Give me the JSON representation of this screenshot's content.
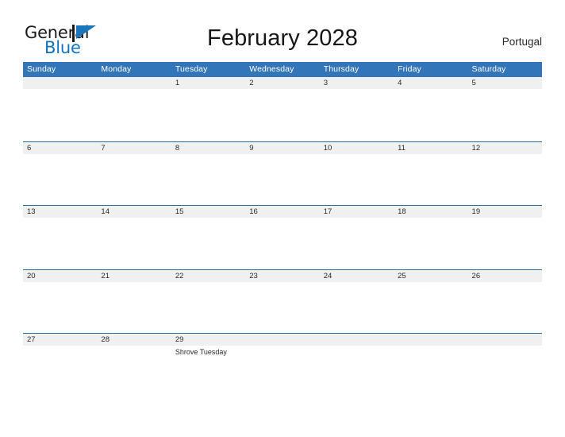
{
  "branding": {
    "name_part1": "General",
    "name_part2": "Blue",
    "flag_color": "#1b75bb",
    "pole_color": "#1a1a1a"
  },
  "header": {
    "title": "February 2028",
    "locale": "Portugal"
  },
  "colors": {
    "weekday_header_bg": "#3275b8",
    "weekday_header_text": "#ffffff",
    "row_divider": "#2a6ba8",
    "date_band_bg": "#f0f0f0",
    "text": "#2b2b2b"
  },
  "calendar": {
    "weekdays": [
      "Sunday",
      "Monday",
      "Tuesday",
      "Wednesday",
      "Thursday",
      "Friday",
      "Saturday"
    ],
    "weeks": [
      [
        {
          "day": "",
          "events": []
        },
        {
          "day": "",
          "events": []
        },
        {
          "day": "1",
          "events": []
        },
        {
          "day": "2",
          "events": []
        },
        {
          "day": "3",
          "events": []
        },
        {
          "day": "4",
          "events": []
        },
        {
          "day": "5",
          "events": []
        }
      ],
      [
        {
          "day": "6",
          "events": []
        },
        {
          "day": "7",
          "events": []
        },
        {
          "day": "8",
          "events": []
        },
        {
          "day": "9",
          "events": []
        },
        {
          "day": "10",
          "events": []
        },
        {
          "day": "11",
          "events": []
        },
        {
          "day": "12",
          "events": []
        }
      ],
      [
        {
          "day": "13",
          "events": []
        },
        {
          "day": "14",
          "events": []
        },
        {
          "day": "15",
          "events": []
        },
        {
          "day": "16",
          "events": []
        },
        {
          "day": "17",
          "events": []
        },
        {
          "day": "18",
          "events": []
        },
        {
          "day": "19",
          "events": []
        }
      ],
      [
        {
          "day": "20",
          "events": []
        },
        {
          "day": "21",
          "events": []
        },
        {
          "day": "22",
          "events": []
        },
        {
          "day": "23",
          "events": []
        },
        {
          "day": "24",
          "events": []
        },
        {
          "day": "25",
          "events": []
        },
        {
          "day": "26",
          "events": []
        }
      ],
      [
        {
          "day": "27",
          "events": []
        },
        {
          "day": "28",
          "events": []
        },
        {
          "day": "29",
          "events": [
            "Shrove Tuesday"
          ]
        },
        {
          "day": "",
          "events": []
        },
        {
          "day": "",
          "events": []
        },
        {
          "day": "",
          "events": []
        },
        {
          "day": "",
          "events": []
        }
      ]
    ]
  }
}
